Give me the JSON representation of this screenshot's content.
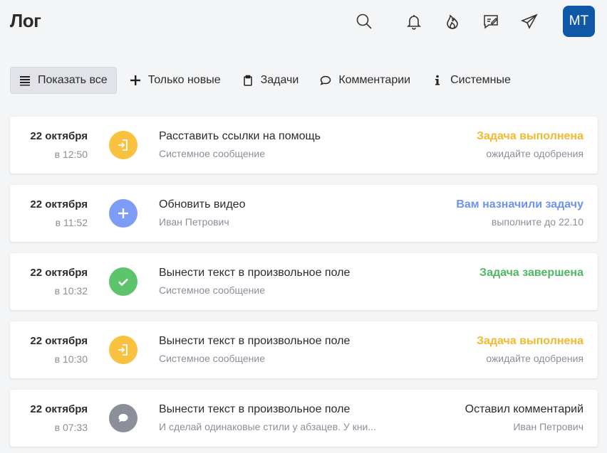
{
  "header": {
    "title": "Лог",
    "icons": [
      "search-icon",
      "bell-icon",
      "fire-icon",
      "message-edit-icon",
      "send-icon"
    ],
    "avatar_initials": "MT"
  },
  "filters": [
    {
      "label": "Показать все",
      "icon": "list-icon",
      "active": true
    },
    {
      "label": "Только новые",
      "icon": "plus-icon",
      "active": false
    },
    {
      "label": "Задачи",
      "icon": "clipboard-icon",
      "active": false
    },
    {
      "label": "Комментарии",
      "icon": "comment-icon",
      "active": false
    },
    {
      "label": "Системные",
      "icon": "info-icon",
      "active": false
    }
  ],
  "colors": {
    "yellow": "#f8c240",
    "blue": "#7d9cf5",
    "green": "#5cc46a",
    "gray": "#8a8f99",
    "avatar": "#0f58a8",
    "status_yellow": "#f5b92e",
    "status_blue": "#6d93ee",
    "status_green": "#4db861"
  },
  "log": [
    {
      "date": "22 октября",
      "time": "в 12:50",
      "icon": "task-import-icon",
      "icon_color": "yellow",
      "title": "Расставить ссылки на помощь",
      "subtitle": "Системное сообщение",
      "status": "Задача выполнена",
      "status_color": "status_yellow",
      "note": "ожидайте одобрения"
    },
    {
      "date": "22 октября",
      "time": "в 11:52",
      "icon": "plus-icon",
      "icon_color": "blue",
      "title": "Обновить видео",
      "subtitle": "Иван Петрович",
      "status": "Вам назначили задачу",
      "status_color": "status_blue",
      "note": "выполните до 22.10"
    },
    {
      "date": "22 октября",
      "time": "в 10:32",
      "icon": "check-icon",
      "icon_color": "green",
      "title": "Вынести текст в произвольное поле",
      "subtitle": "Системное сообщение",
      "status": "Задача завершена",
      "status_color": "status_green",
      "note": ""
    },
    {
      "date": "22 октября",
      "time": "в 10:30",
      "icon": "task-import-icon",
      "icon_color": "yellow",
      "title": "Вынести текст в произвольное поле",
      "subtitle": "Системное сообщение",
      "status": "Задача выполнена",
      "status_color": "status_yellow",
      "note": "ожидайте одобрения"
    },
    {
      "date": "22 октября",
      "time": "в 07:33",
      "icon": "comment-icon",
      "icon_color": "gray",
      "title": "Вынести текст в произвольное поле",
      "subtitle": "И сделай одинаковые стили у абзацев. У кни...",
      "status": "Оставил комментарий",
      "status_color": "dark",
      "note": "Иван Петрович"
    }
  ]
}
